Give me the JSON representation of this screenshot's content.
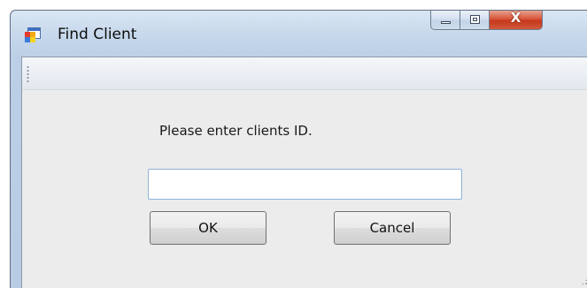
{
  "window": {
    "title": "Find Client",
    "controls": {
      "minimize": "minimize",
      "maximize": "maximize",
      "close": "X"
    }
  },
  "form": {
    "prompt": "Please enter clients ID.",
    "client_id_value": "",
    "ok_label": "OK",
    "cancel_label": "Cancel"
  },
  "icons": {
    "app": "app-window-icon",
    "grip": "toolstrip-grip-icon",
    "size_grip": "resize-grip-icon"
  },
  "colors": {
    "title_bar": "#c8d9ec",
    "close_button": "#c7381c",
    "client_background": "#ececec",
    "input_border": "#8fb2db"
  }
}
